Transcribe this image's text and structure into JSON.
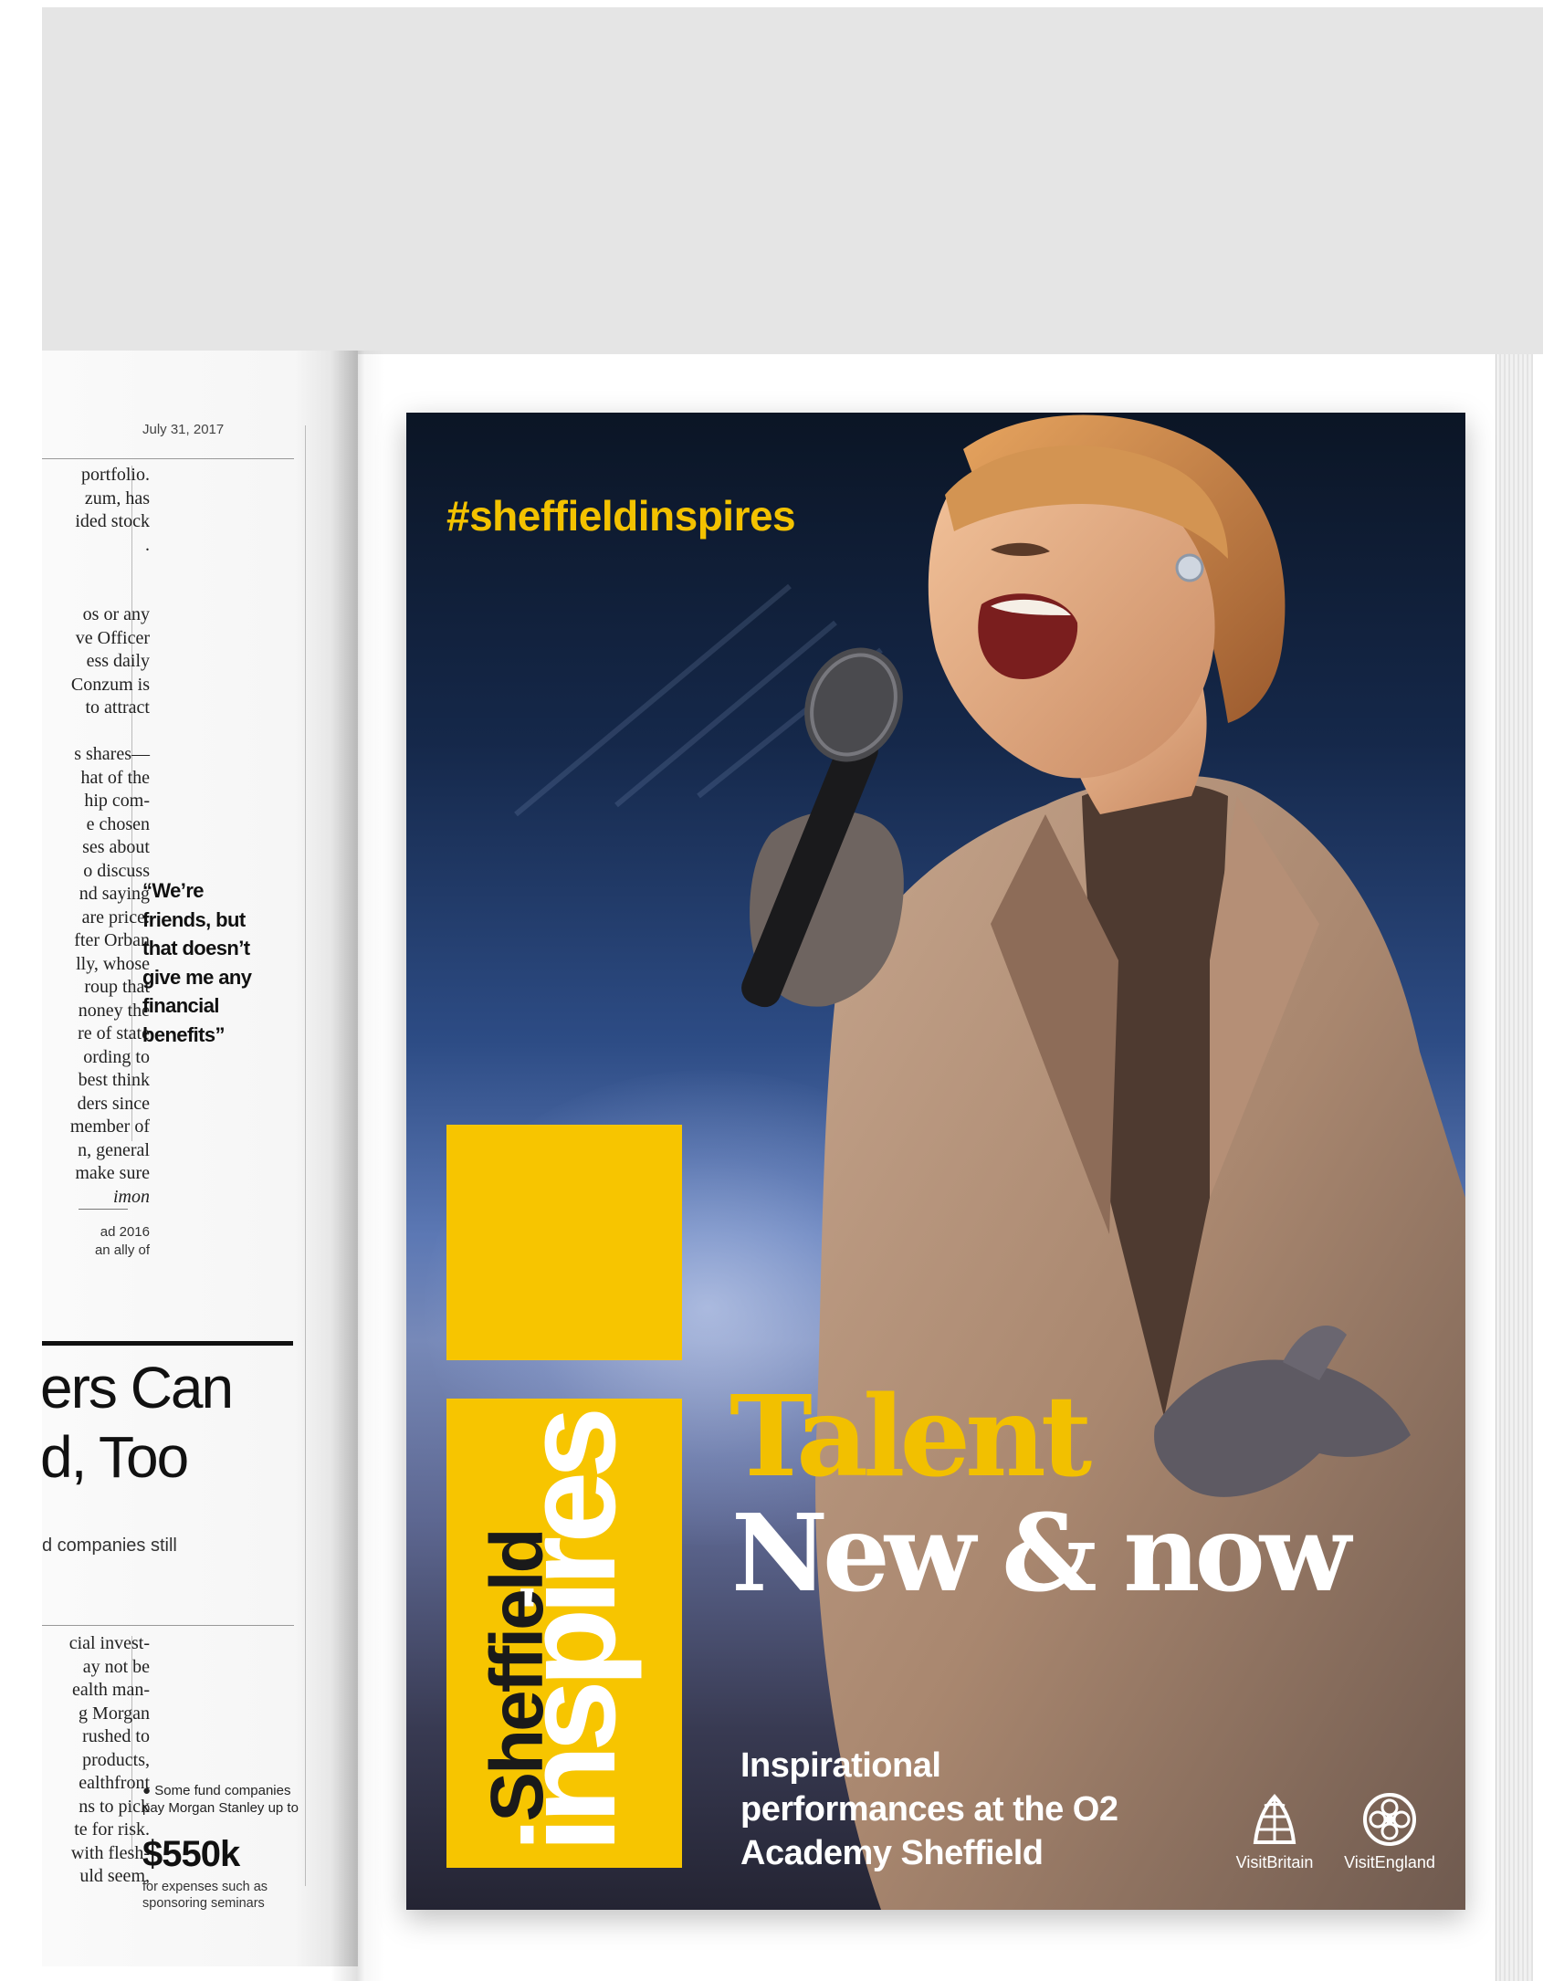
{
  "left_page": {
    "date": "July 31, 2017",
    "column_top": [
      "portfolio.",
      "zum, has",
      "ided stock",
      "."
    ],
    "column_mid": [
      "os or any",
      "ve Officer",
      "ess daily",
      "Conzum is",
      "to attract"
    ],
    "column_main": [
      "s shares—",
      "hat of the",
      "hip com-",
      "e chosen",
      "ses about",
      "o discuss",
      "nd saying",
      "are price.",
      "fter Orban",
      "lly, whose",
      "roup that",
      "noney the",
      "re of state",
      "ording to",
      "best think",
      "ders since",
      "member of",
      "n, general",
      "make sure",
      "imon"
    ],
    "column_foot": [
      "ad 2016",
      "an ally of"
    ],
    "pull_quote": "“We’re friends, but that doesn’t give me any financial benefits”",
    "headline_line1": "ers Can",
    "headline_line2": "d, Too",
    "subhead": "d companies still",
    "column_bottom": [
      "cial invest-",
      "ay not be",
      "ealth man-",
      "g Morgan",
      "rushed to",
      "products,",
      "ealthfront",
      "ns to pick",
      "te for risk.",
      "with flesh-",
      "uld seem,"
    ],
    "fund_note": "● Some fund companies pay Morgan Stanley up to",
    "fund_amount": "$550k",
    "fund_note_small": "for expenses such as sponsoring seminars"
  },
  "poster": {
    "hashtag": "#sheffieldinspires",
    "brand_line1": "Sheffield",
    "brand_line2": "inspires",
    "title_line1": "Talent",
    "title_line2": "New & now",
    "tagline_lines": [
      "Inspirational",
      "performances at the O2",
      "Academy Sheffield"
    ],
    "logos": [
      {
        "label": "VisitBritain",
        "icon": "lion-unicorn-icon"
      },
      {
        "label": "VisitEngland",
        "icon": "tudor-rose-icon"
      }
    ],
    "colors": {
      "accent_yellow": "#f7c500",
      "headline_yellow": "#f2c000",
      "text_white": "#ffffff"
    }
  }
}
